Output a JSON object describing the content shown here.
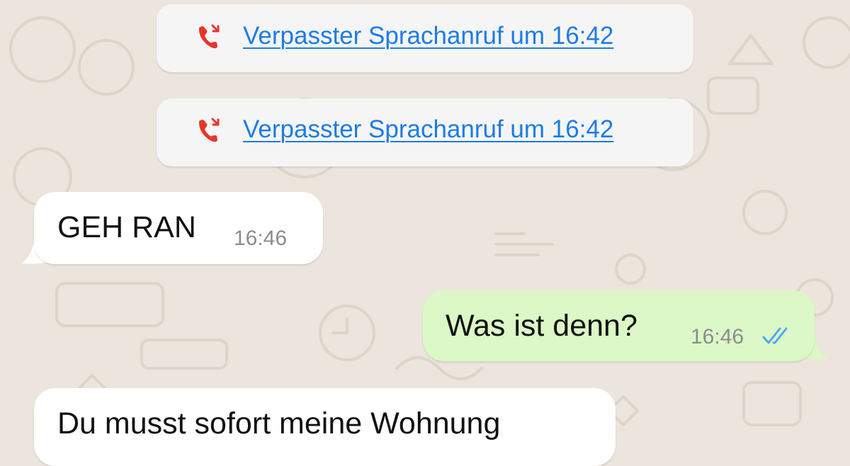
{
  "theme": {
    "background": "#ece5dd",
    "incoming_bubble": "#ffffff",
    "outgoing_bubble": "#dcf8c6",
    "link_color": "#1c7ce6",
    "missed_call_color": "#e8352b",
    "read_ticks_color": "#4fa8f0"
  },
  "messages": [
    {
      "kind": "missed-call",
      "icon": "missed-call-icon",
      "text": "Verpasster Sprachanruf um 16:42"
    },
    {
      "kind": "missed-call",
      "icon": "missed-call-icon",
      "text": "Verpasster Sprachanruf um 16:42"
    },
    {
      "kind": "incoming",
      "text": "GEH RAN",
      "time": "16:46"
    },
    {
      "kind": "outgoing",
      "text": "Was ist denn?",
      "time": "16:46",
      "status_icon": "double-check-read-icon"
    },
    {
      "kind": "incoming",
      "text": "Du musst sofort meine Wohnung"
    }
  ]
}
